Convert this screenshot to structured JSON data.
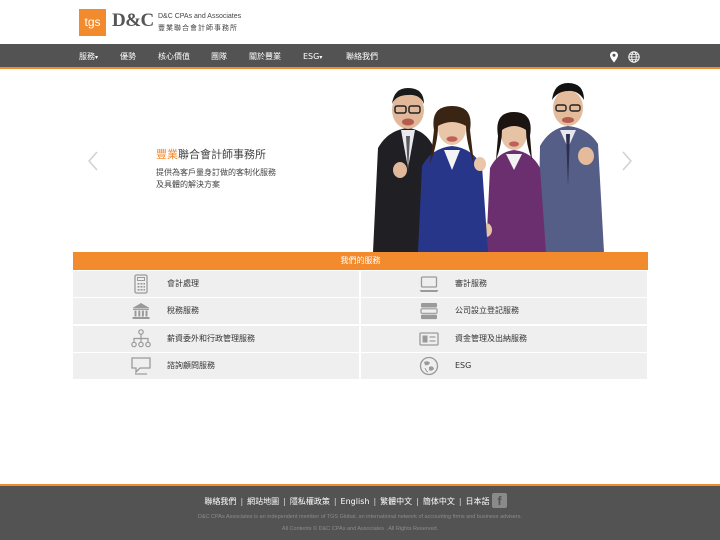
{
  "brand": {
    "logo_mark": "tgs",
    "logo_name": "D&C",
    "name_en": "D&C CPAs and Associates",
    "name_zh": "豐業聯合會計師事務所",
    "accent": "#f28a2e",
    "nav_bg": "#535353"
  },
  "nav": {
    "items": [
      {
        "label": "服務",
        "dropdown": true
      },
      {
        "label": "優勢",
        "dropdown": false
      },
      {
        "label": "核心價值",
        "dropdown": false
      },
      {
        "label": "團隊",
        "dropdown": false
      },
      {
        "label": "關於豐業",
        "dropdown": false
      },
      {
        "label": "ESG",
        "dropdown": true
      },
      {
        "label": "聯絡我們",
        "dropdown": false
      }
    ],
    "caret": "▾",
    "icons": [
      "location-pin-icon",
      "globe-icon"
    ]
  },
  "hero": {
    "title_highlight": "豐業",
    "title_rest": "聯合會計師事務所",
    "subtitle_line1": "提供為客戶量身訂做的客制化服務",
    "subtitle_line2": "及具體的解決方案"
  },
  "services": {
    "heading": "我們的服務",
    "items": [
      {
        "label": "會計處理",
        "icon": "calculator-icon"
      },
      {
        "label": "審計服務",
        "icon": "laptop-icon"
      },
      {
        "label": "稅務服務",
        "icon": "bank-icon"
      },
      {
        "label": "公司設立登記服務",
        "icon": "server-icon"
      },
      {
        "label": "薪資委外和行政管理服務",
        "icon": "org-chart-icon"
      },
      {
        "label": "資金管理及出納服務",
        "icon": "money-icon"
      },
      {
        "label": "諮詢顧問服務",
        "icon": "chat-icon"
      },
      {
        "label": "ESG",
        "icon": "globe-leaf-icon"
      }
    ]
  },
  "footer": {
    "links": [
      "聯絡我們",
      "網站地圖",
      "隱私權政策",
      "English",
      "繁體中文",
      "簡体中文",
      "日本語"
    ],
    "separator": "|",
    "facebook_label": "f",
    "note1": "D&C CPAs Associates is an independent member of TGS Global, an international network of accounting firms and business advisers.",
    "note2": "All Contents © D&C CPAs and Associates . All Rights Reserved."
  }
}
